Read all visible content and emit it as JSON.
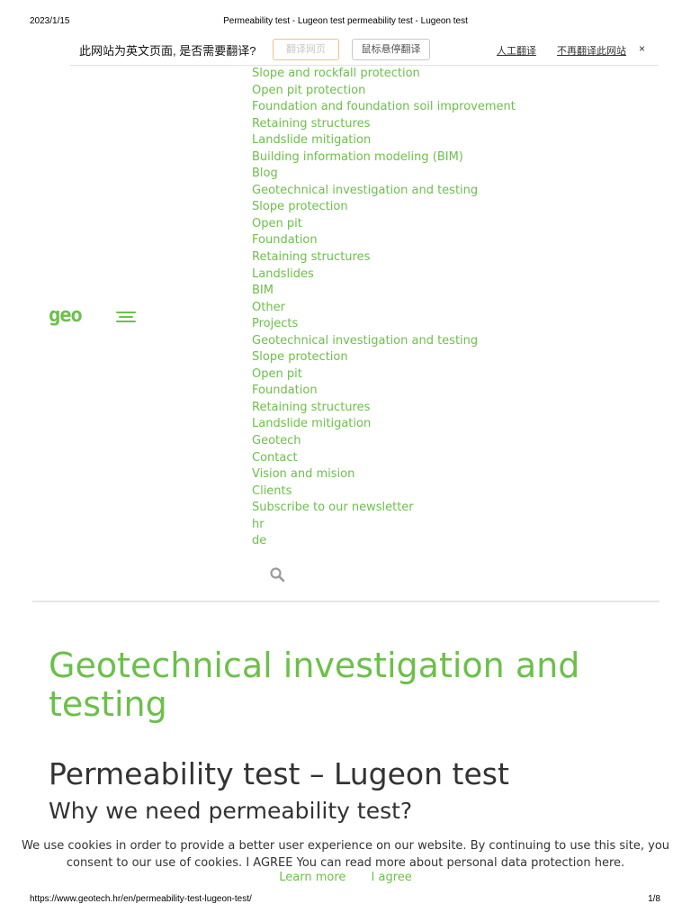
{
  "print_header": {
    "date": "2023/1/15",
    "title": "Permeability test - Lugeon test permeability test - Lugeon test"
  },
  "translate_bar": {
    "prompt": "此网站为英文页面, 是否需要翻译?",
    "translate_button": "翻译网页",
    "hover_button": "鼠标悬停翻译",
    "human_translate": "人工翻译",
    "never_translate": "不再翻译此网站",
    "close": "×"
  },
  "logo": {
    "text": "geo"
  },
  "nav": {
    "items": [
      "Slope and rockfall protection",
      "Open pit protection",
      "Foundation and foundation soil improvement",
      "Retaining structures",
      "Landslide mitigation",
      "Building information modeling (BIM)",
      "Blog",
      "Geotechnical investigation and testing",
      "Slope protection",
      "Open pit",
      "Foundation",
      "Retaining structures",
      "Landslides",
      "BIM",
      "Other",
      "Projects",
      "Geotechnical investigation and testing",
      "Slope protection",
      "Open pit",
      "Foundation",
      "Retaining structures",
      "Landslide mitigation",
      "Geotech",
      "Contact",
      "Vision and mision",
      "Clients",
      "Subscribe to our newsletter",
      "hr",
      "de"
    ]
  },
  "content": {
    "category_title": "Geotechnical investigation and testing",
    "page_title": "Permeability test – Lugeon test",
    "section_heading": "Why we need permeability test?"
  },
  "cookie": {
    "text": "We use cookies in order to provide a better user experience on our website. By continuing to use this site, you consent to our use of cookies. I AGREE You can read more about personal data protection here.",
    "learn_more": "Learn more",
    "agree": "I agree"
  },
  "print_footer": {
    "url": "https://www.geotech.hr/en/permeability-test-lugeon-test/",
    "page": "1/8"
  },
  "colors": {
    "accent": "#6cc04a",
    "text": "#333333"
  }
}
